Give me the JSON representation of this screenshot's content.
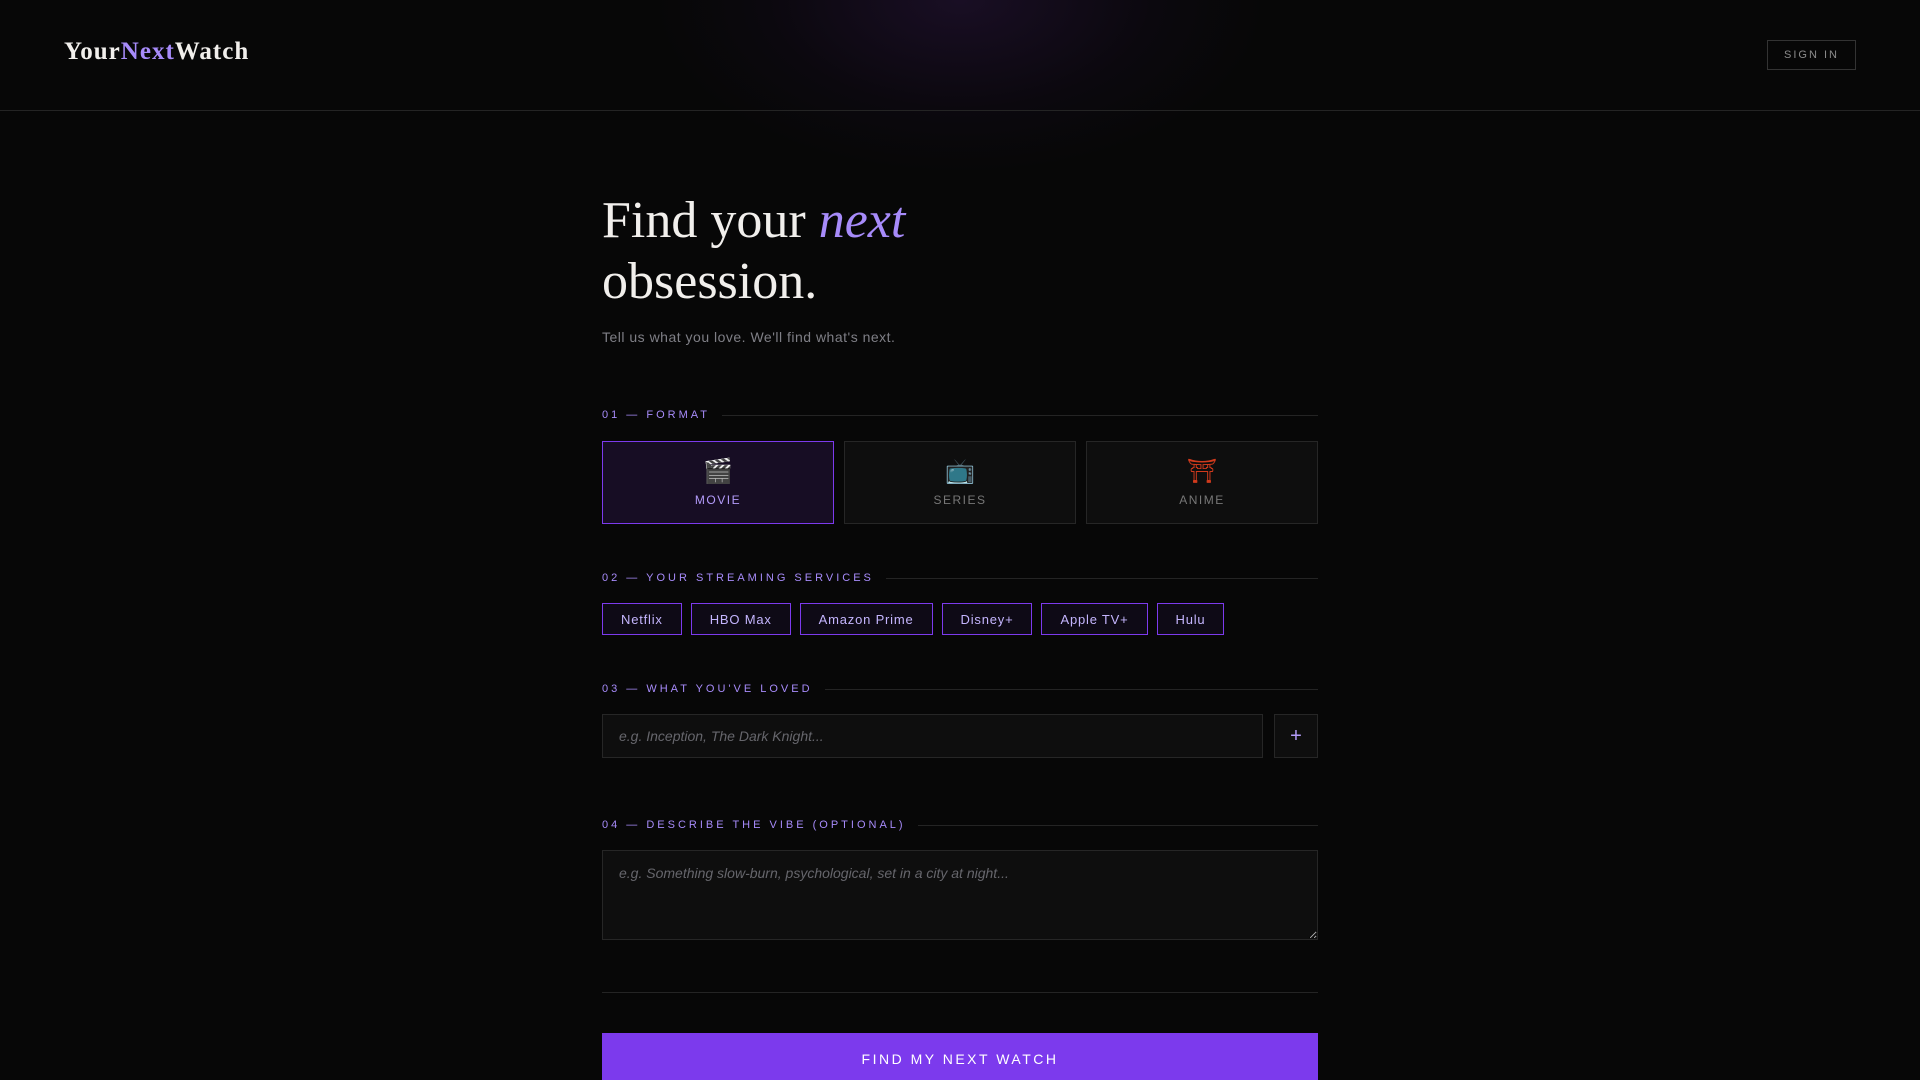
{
  "header": {
    "logo": {
      "part1": "Your",
      "part2": "Next",
      "part3": "Watch"
    },
    "signin_label": "SIGN IN"
  },
  "hero": {
    "title_before": "Find your ",
    "title_emphasis": "next",
    "title_after": "obsession.",
    "subtitle": "Tell us what you love. We'll find what's next."
  },
  "sections": {
    "format": {
      "label": "01 — FORMAT",
      "selected": "MOVIE",
      "options": [
        {
          "label": "MOVIE",
          "icon": "🎬",
          "icon_name": "clapperboard-icon"
        },
        {
          "label": "SERIES",
          "icon": "📺",
          "icon_name": "television-icon"
        },
        {
          "label": "ANIME",
          "icon": "⛩",
          "icon_name": "torii-gate-icon"
        }
      ]
    },
    "services": {
      "label": "02 — YOUR STREAMING SERVICES",
      "items": [
        "Netflix",
        "HBO Max",
        "Amazon Prime",
        "Disney+",
        "Apple TV+",
        "Hulu"
      ]
    },
    "loved": {
      "label": "03 — WHAT YOU'VE LOVED",
      "placeholder": "e.g. Inception, The Dark Knight...",
      "value": "",
      "add_label": "+"
    },
    "vibe": {
      "label": "04 — DESCRIBE THE VIBE (OPTIONAL)",
      "placeholder": "e.g. Something slow-burn, psychological, set in a city at night...",
      "value": ""
    }
  },
  "cta_label": "FIND MY NEXT WATCH",
  "colors": {
    "accent": "#a78bfa",
    "primary": "#7c3aed",
    "background": "#070707",
    "anime_icon": "#d03a1c"
  }
}
